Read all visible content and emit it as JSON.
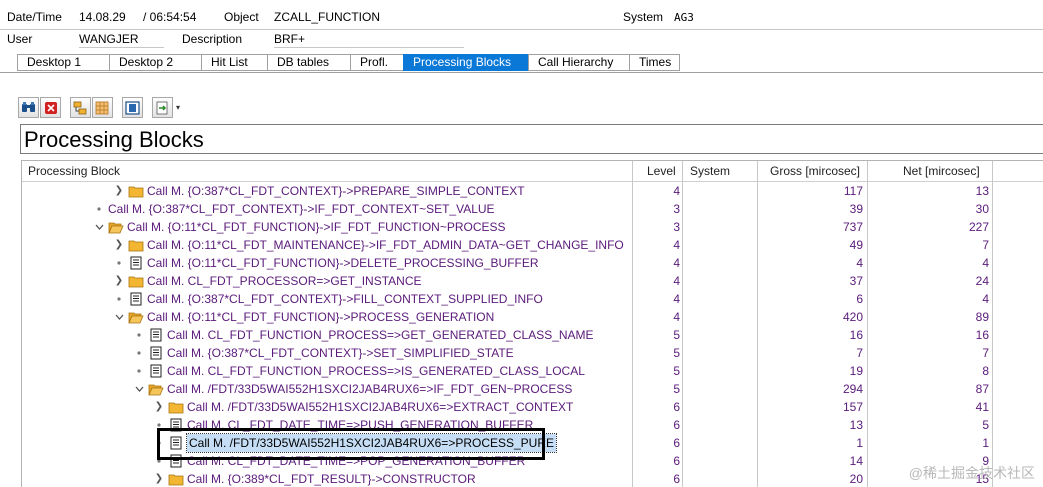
{
  "header": {
    "date_time_label": "Date/Time",
    "date_value": "14.08.29",
    "time_value": "/ 06:54:54",
    "object_label": "Object",
    "object_value": "ZCALL_FUNCTION",
    "system_label": "System",
    "system_value": "AG3",
    "user_label": "User",
    "user_value": "WANGJER",
    "description_label": "Description",
    "description_value": "BRF+"
  },
  "tabs": [
    {
      "label": "Desktop 1"
    },
    {
      "label": "Desktop 2"
    },
    {
      "label": "Hit List"
    },
    {
      "label": "DB tables"
    },
    {
      "label": "Profl."
    },
    {
      "label": "Processing Blocks",
      "active": true
    },
    {
      "label": "Call Hierarchy"
    },
    {
      "label": "Times"
    }
  ],
  "toolbar": {
    "icons": [
      "binoculars-icon",
      "stop-icon",
      "expand-icon",
      "collapse-icon",
      "layout-icon",
      "export-icon"
    ]
  },
  "title": "Processing Blocks",
  "grid": {
    "columns": {
      "block": "Processing Block",
      "level": "Level",
      "system": "System",
      "gross": "Gross [mircosec]",
      "net": "Net [mircosec]"
    },
    "rows": [
      {
        "name": "Call M. {O:387*CL_FDT_CONTEXT}->PREPARE_SIMPLE_CONTEXT",
        "level": "4",
        "gross": "117",
        "net": "13",
        "icon": "folder",
        "state": "collapsed"
      },
      {
        "name": "Call M. {O:387*CL_FDT_CONTEXT}->IF_FDT_CONTEXT~SET_VALUE",
        "level": "3",
        "gross": "39",
        "net": "30",
        "icon": "none",
        "state": "leaf"
      },
      {
        "name": "Call M. {O:11*CL_FDT_FUNCTION}->IF_FDT_FUNCTION~PROCESS",
        "level": "3",
        "gross": "737",
        "net": "227",
        "icon": "folder-open",
        "state": "expanded"
      },
      {
        "name": "Call M. {O:11*CL_FDT_MAINTENANCE}->IF_FDT_ADMIN_DATA~GET_CHANGE_INFO",
        "level": "4",
        "gross": "49",
        "net": "7",
        "icon": "folder",
        "state": "collapsed"
      },
      {
        "name": "Call M. {O:11*CL_FDT_FUNCTION}->DELETE_PROCESSING_BUFFER",
        "level": "4",
        "gross": "4",
        "net": "4",
        "icon": "doc",
        "state": "leaf"
      },
      {
        "name": "Call M. CL_FDT_PROCESSOR=>GET_INSTANCE",
        "level": "4",
        "gross": "37",
        "net": "24",
        "icon": "folder",
        "state": "collapsed"
      },
      {
        "name": "Call M. {O:387*CL_FDT_CONTEXT}->FILL_CONTEXT_SUPPLIED_INFO",
        "level": "4",
        "gross": "6",
        "net": "4",
        "icon": "doc",
        "state": "leaf"
      },
      {
        "name": "Call M. {O:11*CL_FDT_FUNCTION}->PROCESS_GENERATION",
        "level": "4",
        "gross": "420",
        "net": "89",
        "icon": "folder-open",
        "state": "expanded"
      },
      {
        "name": "Call M. CL_FDT_FUNCTION_PROCESS=>GET_GENERATED_CLASS_NAME",
        "level": "5",
        "gross": "16",
        "net": "16",
        "icon": "doc",
        "state": "leaf"
      },
      {
        "name": "Call M. {O:387*CL_FDT_CONTEXT}->SET_SIMPLIFIED_STATE",
        "level": "5",
        "gross": "7",
        "net": "7",
        "icon": "doc",
        "state": "leaf"
      },
      {
        "name": "Call M. CL_FDT_FUNCTION_PROCESS=>IS_GENERATED_CLASS_LOCAL",
        "level": "5",
        "gross": "19",
        "net": "8",
        "icon": "doc",
        "state": "leaf"
      },
      {
        "name": "Call M. /FDT/33D5WAI552H1SXCI2JAB4RUX6=>IF_FDT_GEN~PROCESS",
        "level": "5",
        "gross": "294",
        "net": "87",
        "icon": "folder-open",
        "state": "expanded"
      },
      {
        "name": "Call M. /FDT/33D5WAI552H1SXCI2JAB4RUX6=>EXTRACT_CONTEXT",
        "level": "6",
        "gross": "157",
        "net": "41",
        "icon": "folder",
        "state": "collapsed"
      },
      {
        "name": "Call M. CL_FDT_DATE_TIME=>PUSH_GENERATION_BUFFER",
        "level": "6",
        "gross": "13",
        "net": "5",
        "icon": "doc",
        "state": "leaf"
      },
      {
        "name": "Call M. /FDT/33D5WAI552H1SXCI2JAB4RUX6=>PROCESS_PURE",
        "level": "6",
        "gross": "1",
        "net": "1",
        "icon": "doc",
        "state": "leaf",
        "selected": true
      },
      {
        "name": "Call M. CL_FDT_DATE_TIME=>POP_GENERATION_BUFFER",
        "level": "6",
        "gross": "14",
        "net": "9",
        "icon": "doc",
        "state": "leaf"
      },
      {
        "name": "Call M. {O:389*CL_FDT_RESULT}->CONSTRUCTOR",
        "level": "6",
        "gross": "20",
        "net": "15",
        "icon": "folder",
        "state": "collapsed"
      }
    ]
  },
  "watermark": "@稀土掘金技术社区"
}
